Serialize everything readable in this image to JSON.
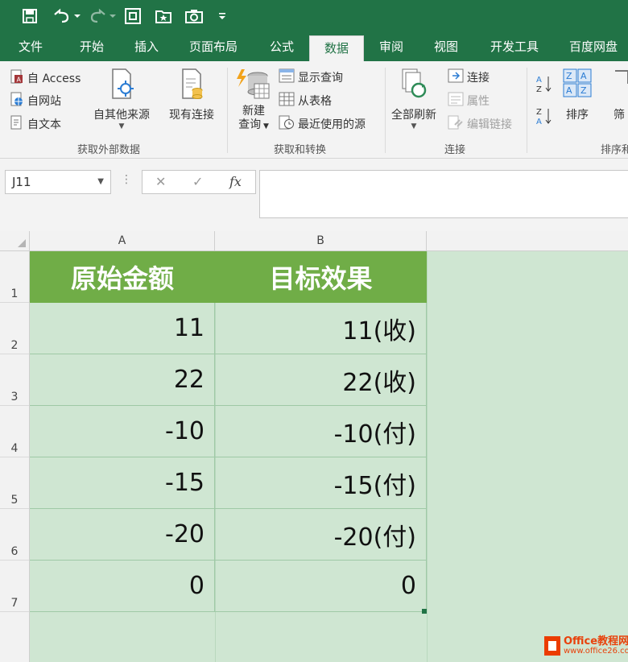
{
  "tabs": [
    "文件",
    "开始",
    "插入",
    "页面布局",
    "公式",
    "数据",
    "审阅",
    "视图",
    "开发工具",
    "百度网盘"
  ],
  "active_tab": "数据",
  "ribbon": {
    "get_external": {
      "access": "自 Access",
      "web": "自网站",
      "text": "自文本",
      "other": "自其他来源",
      "existing": "现有连接",
      "label": "获取外部数据"
    },
    "transform": {
      "new_query_1": "新建",
      "new_query_2": "查询",
      "show_queries": "显示查询",
      "from_table": "从表格",
      "recent_sources": "最近使用的源",
      "label": "获取和转换"
    },
    "connections": {
      "refresh_all": "全部刷新",
      "connections": "连接",
      "properties": "属性",
      "edit_links": "编辑链接",
      "label": "连接"
    },
    "sort": {
      "sort": "排序",
      "filter_partial": "筛",
      "label_partial": "排序和"
    }
  },
  "formula_bar": {
    "name_box": "J11",
    "cancel": "✕",
    "enter": "✓",
    "fx": "fx",
    "value": ""
  },
  "columns": [
    "A",
    "B"
  ],
  "rows": [
    {
      "num": "1",
      "a": "原始金额",
      "b": "目标效果"
    },
    {
      "num": "2",
      "a": "11",
      "b": "11(收)"
    },
    {
      "num": "3",
      "a": "22",
      "b": "22(收)"
    },
    {
      "num": "4",
      "a": "-10",
      "b": "-10(付)"
    },
    {
      "num": "5",
      "a": "-15",
      "b": "-15(付)"
    },
    {
      "num": "6",
      "a": "-20",
      "b": "-20(付)"
    },
    {
      "num": "7",
      "a": "0",
      "b": "0"
    }
  ],
  "watermark": {
    "line1": "Office教程网",
    "line2": "www.office26.com"
  },
  "colors": {
    "excel_green": "#217346",
    "header_fill": "#70ad47",
    "cell_fill": "#cfe6d2"
  }
}
